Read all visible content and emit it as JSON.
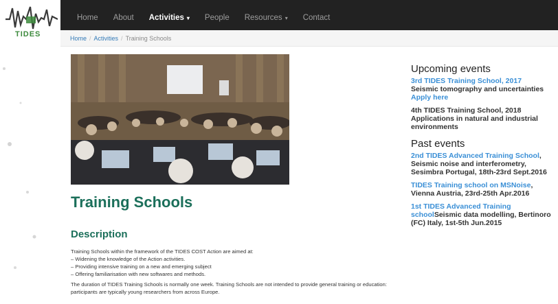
{
  "nav": {
    "logo_text": "TIDES",
    "items": [
      {
        "label": "Home",
        "active": false,
        "dropdown": false
      },
      {
        "label": "About",
        "active": false,
        "dropdown": false
      },
      {
        "label": "Activities",
        "active": true,
        "dropdown": true
      },
      {
        "label": "People",
        "active": false,
        "dropdown": false
      },
      {
        "label": "Resources",
        "active": false,
        "dropdown": true
      },
      {
        "label": "Contact",
        "active": false,
        "dropdown": false
      }
    ],
    "caret": "▾"
  },
  "breadcrumb": {
    "items": [
      "Home",
      "Activities"
    ],
    "current": "Training Schools",
    "separator": "/"
  },
  "main": {
    "title": "Training Schools",
    "section_title": "Description",
    "paragraph1_lines": [
      "Training Schools within the framework of the TIDES COST Action are aimed at:",
      "– Widening the knowledge of the Action activities.",
      "– Providing intensive training on a new and emerging subject",
      "– Offering familiarisation with new softwares and methods."
    ],
    "paragraph2": "The duration of TIDES Training Schools is normally one week. Training Schools are not intended to provide general training or education: participants are typically young researchers from across Europe."
  },
  "sidebar": {
    "upcoming_heading": "Upcoming events",
    "upcoming": [
      {
        "link": "3rd TIDES Training School, 2017",
        "text": "Seismic tomography and uncertainties",
        "link2": "Apply here"
      },
      {
        "link": "",
        "text": "4th TIDES Training School, 2018 Applications in natural and industrial environments",
        "link2": ""
      }
    ],
    "past_heading": "Past events",
    "past": [
      {
        "link": "2nd TIDES Advanced Training School",
        "text": ", Seismic noise and interferometry, Sesimbra Portugal, 18th-23rd Sept.2016"
      },
      {
        "link": "TIDES Training school on MSNoise",
        "text": ", Vienna Austria, 23rd-25th Apr.2016"
      },
      {
        "link": "1st TIDES Advanced Training school",
        "text": "Seismic data modelling, Bertinoro (FC) Italy, 1st-5th Jun.2015"
      }
    ]
  },
  "colors": {
    "navbar": "#222222",
    "heading_green": "#1b6f5a",
    "link_blue": "#3a8fd6"
  }
}
